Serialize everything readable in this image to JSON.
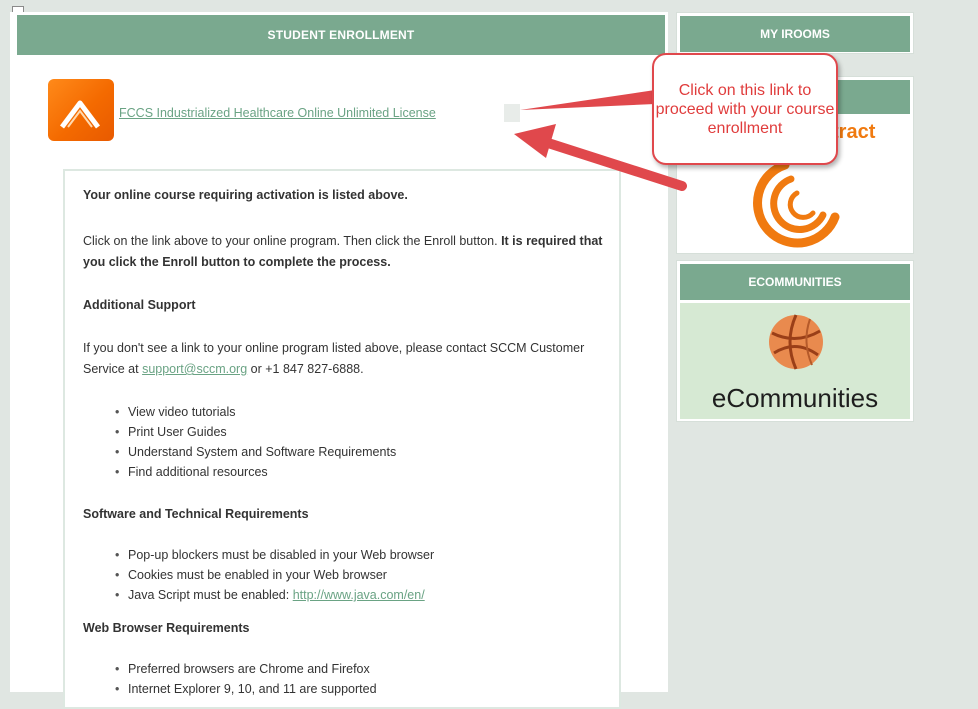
{
  "main": {
    "header": "STUDENT ENROLLMENT",
    "course_link": "FCCS Industrialized Healthcare Online Unlimited License",
    "content": {
      "intro": "Your online course requiring activation is listed above.",
      "instructions_plain": "Click on the link above to your online program. Then click the Enroll button.",
      "instructions_bold": "It is required that you click the Enroll button to complete the process.",
      "additional_support_heading": "Additional Support",
      "support_text_1": "If you don't see a link to your online program listed above, please contact SCCM Customer Service at",
      "support_email": "support@sccm.org",
      "support_text_2": "or +1 847 827-6888.",
      "support_items": [
        "View video tutorials",
        "Print User Guides",
        "Understand System and Software Requirements",
        "Find additional resources"
      ],
      "software_heading": "Software and Technical Requirements",
      "software_items": [
        "Pop-up blockers must be disabled in your Web browser",
        "Cookies must be enabled in your Web browser"
      ],
      "java_text": "Java Script must be enabled:",
      "java_link": "http://www.java.com/en/",
      "browser_heading": "Web Browser Requirements",
      "browser_items": [
        "Preferred browsers are Chrome and Firefox",
        "Internet Explorer 9, 10, and 11 are supported"
      ]
    }
  },
  "sidebar": {
    "myirooms_header": "MY IROOMS",
    "abstract_label": "tract",
    "ecommunities_header": "eCOMMUNITIES",
    "ecommunities_label": "eCommunities"
  },
  "callout": {
    "text": "Click on this link to proceed with your course enrollment",
    "color": "#e03c3c"
  },
  "colors": {
    "header_green": "#7aa98f",
    "link_green": "#6aa384",
    "accent_orange": "#f07a10",
    "page_bg": "#e0e6e2"
  }
}
